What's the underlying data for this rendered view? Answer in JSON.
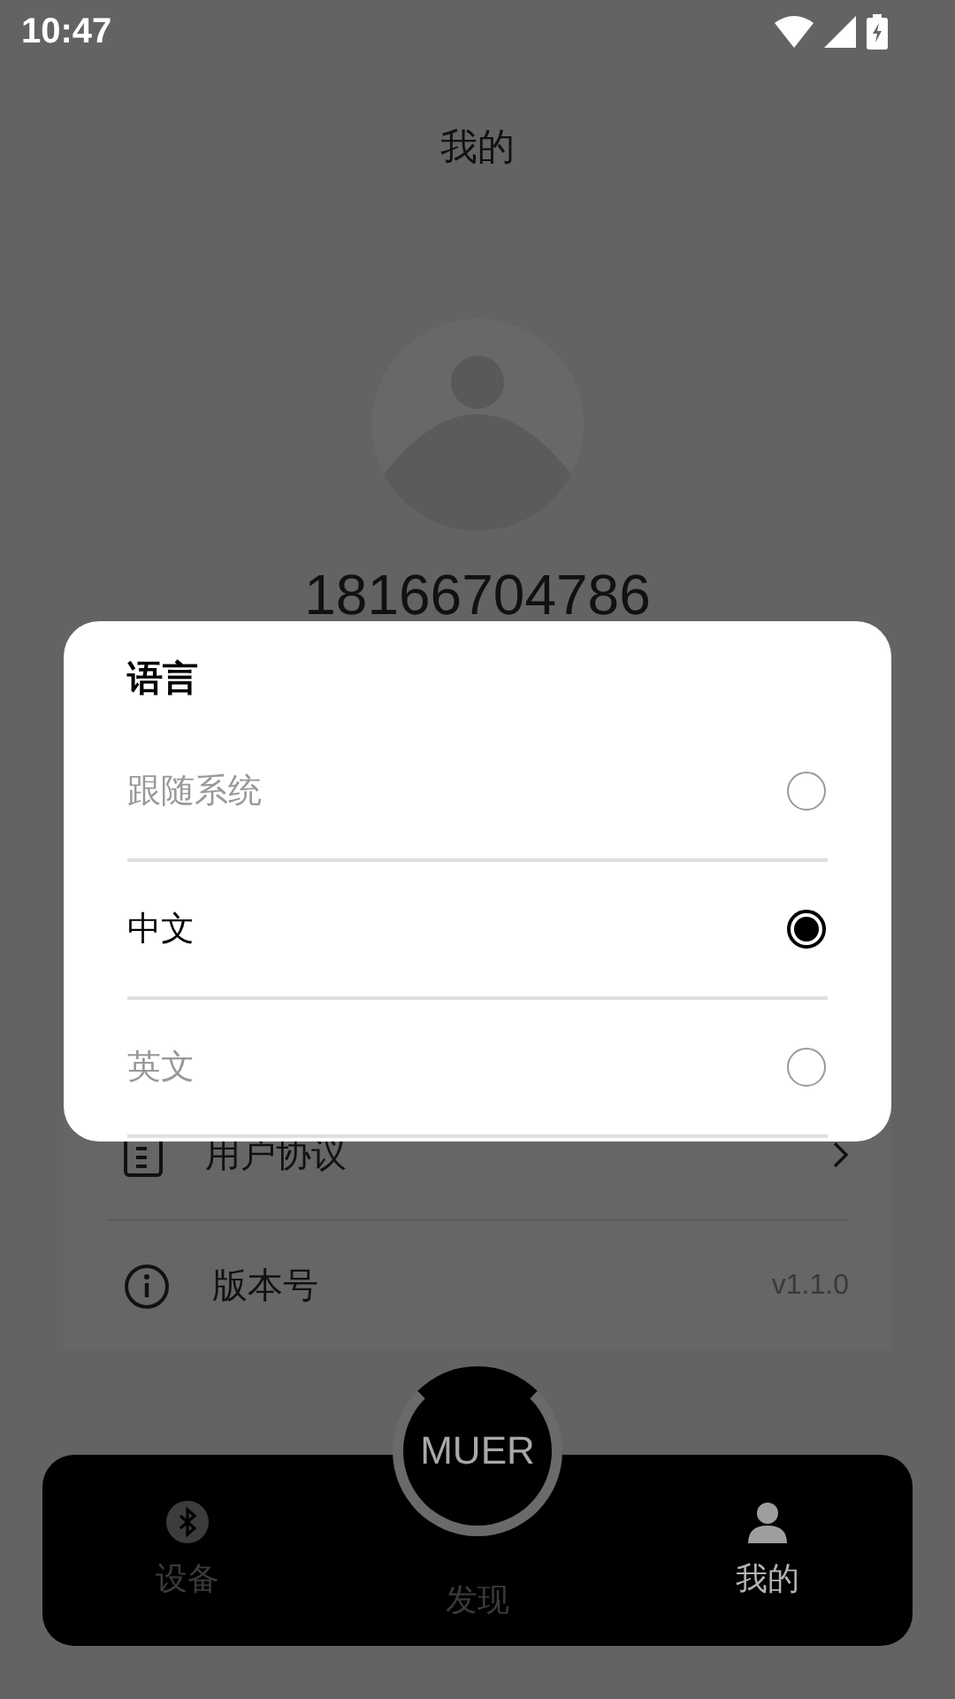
{
  "status_bar": {
    "time": "10:47"
  },
  "header": {
    "title": "我的"
  },
  "profile": {
    "phone": "18166704786"
  },
  "menu": [
    {
      "kind": "link",
      "label": "用户协议"
    },
    {
      "kind": "info",
      "label": "版本号",
      "value": "v1.1.0"
    }
  ],
  "dialog": {
    "title": "语言",
    "options": [
      {
        "label": "跟随系统",
        "selected": false
      },
      {
        "label": "中文",
        "selected": true
      },
      {
        "label": "英文",
        "selected": false
      }
    ]
  },
  "bottom_nav": {
    "center_button": "MUER",
    "tabs": [
      {
        "label": "设备",
        "selected": false
      },
      {
        "label": "发现",
        "selected": false
      },
      {
        "label": "我的",
        "selected": true
      }
    ]
  }
}
